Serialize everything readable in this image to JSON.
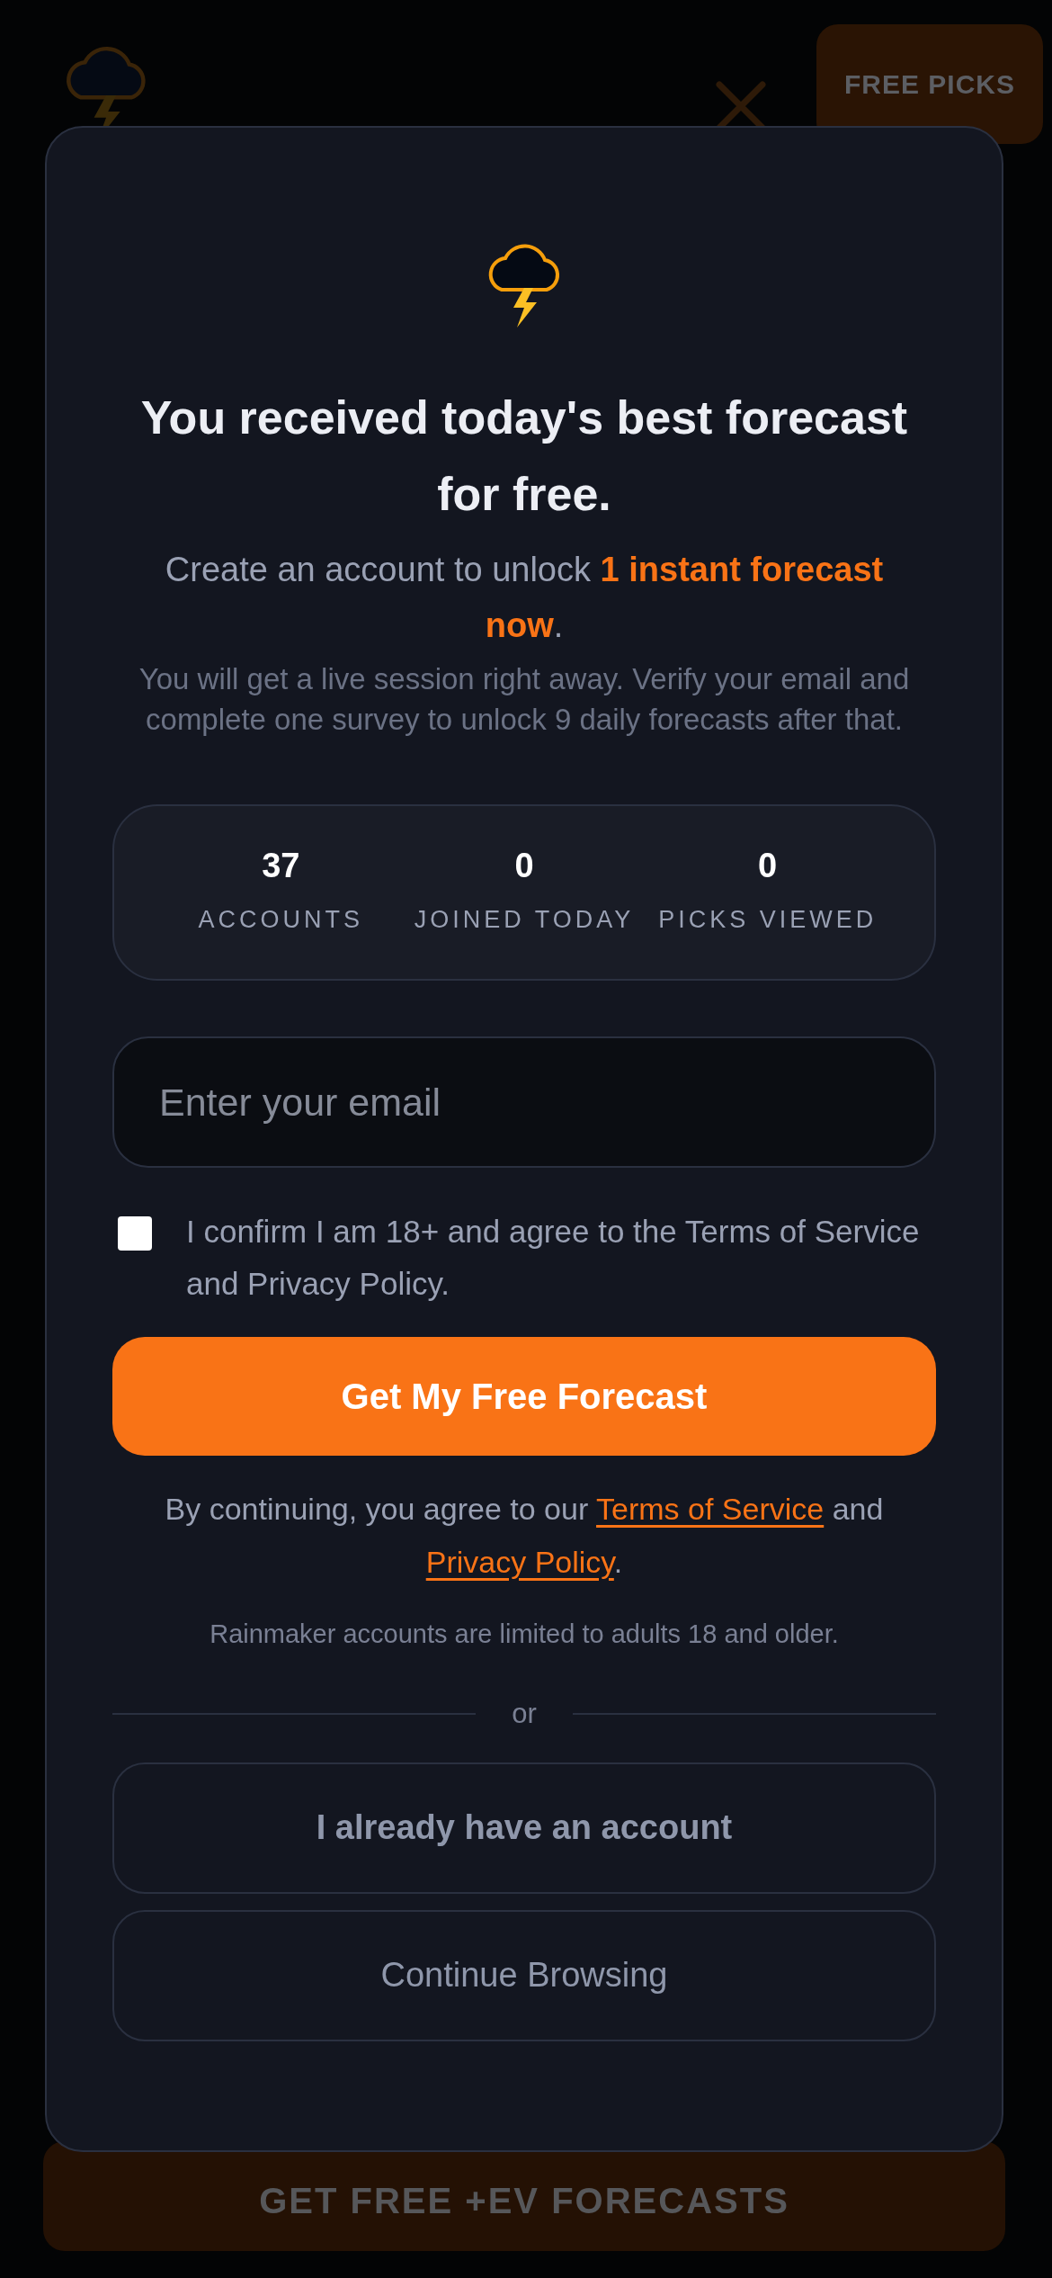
{
  "header": {
    "free_picks_button": "FREE PICKS"
  },
  "modal": {
    "title": "You received today's best forecast for free.",
    "subtitle": "Create an account to unlock **1 instant forecast now**.",
    "description": "You will get a live session right away. Verify your email and complete one survey to unlock 9 daily forecasts after that.",
    "stats": [
      {
        "value": "37",
        "label": "ACCOUNTS"
      },
      {
        "value": "0",
        "label": "JOINED TODAY"
      },
      {
        "value": "0",
        "label": "PICKS VIEWED"
      }
    ],
    "email": {
      "placeholder": "Enter your email"
    },
    "consent": {
      "checked": false,
      "label": "I confirm I am 18+ and agree to the Terms of Service and Privacy Policy."
    },
    "submit_button": "Get My Free Forecast",
    "legal": [
      {
        "kind": "text",
        "text": "By continuing, you agree to our "
      },
      {
        "kind": "link",
        "text": "Terms of Service"
      },
      {
        "kind": "text",
        "text": " and "
      },
      {
        "kind": "link",
        "text": "Privacy Policy"
      },
      {
        "kind": "text",
        "text": "."
      }
    ],
    "age_note": "Rainmaker accounts are limited to adults 18 and older.",
    "divider": "or",
    "secondary_buttons": [
      {
        "kind": "primary",
        "label": "I already have an account"
      },
      {
        "kind": "plain",
        "label": "Continue Browsing"
      }
    ]
  },
  "bottom_button": "GET FREE +EV FORECASTS"
}
